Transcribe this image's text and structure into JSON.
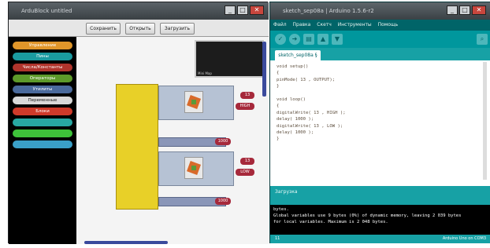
{
  "left": {
    "title": "ArduBlock untitled",
    "toolbar": [
      "Сохранить",
      "Открыть",
      "Загрузить"
    ],
    "categories": [
      {
        "label": "Управление",
        "color": "#e0962a"
      },
      {
        "label": "Пины",
        "color": "#1a9aa0"
      },
      {
        "label": "Числа/Константы",
        "color": "#b0342c"
      },
      {
        "label": "Операторы",
        "color": "#5d9a2a"
      },
      {
        "label": "Утилиты",
        "color": "#4a6a9c"
      },
      {
        "label": "Переменные",
        "color": "#d9d9d9"
      },
      {
        "label": "Блоки",
        "color": "#cf3a2a"
      },
      {
        "label": "",
        "color": "#28a8a2"
      },
      {
        "label": "",
        "color": "#3ec23a"
      },
      {
        "label": "",
        "color": "#3aa0c8"
      }
    ],
    "blocks": {
      "main_label": "",
      "top_label": "",
      "digital_label": "",
      "delay_values": [
        "1000",
        "1000"
      ],
      "pin_values": [
        "13",
        "13"
      ],
      "state_values": [
        "HIGH",
        "LOW"
      ]
    },
    "minimap_label": "Mini Map"
  },
  "right": {
    "title": "sketch_sep08a | Arduino 1.5.6-r2",
    "menu": [
      "Файл",
      "Правка",
      "Скетч",
      "Инструменты",
      "Помощь"
    ],
    "tab": "sketch_sep08a §",
    "code": [
      "void setup()",
      "{",
      "pinMode( 13 , OUTPUT);",
      "}",
      "",
      "void loop()",
      "{",
      "digitalWrite( 13 , HIGH );",
      "delay( 1000 );",
      "digitalWrite( 13 , LOW );",
      "delay( 1000 );",
      "}"
    ],
    "status": "Загрузка",
    "console": [
      "bytes.",
      "Global variables use 9 bytes (0%) of dynamic memory, leaving 2 039 bytes",
      "for local variables. Maximum is 2 048 bytes."
    ],
    "footer_left": "11",
    "footer_right": "Arduino Uno on COM3"
  }
}
